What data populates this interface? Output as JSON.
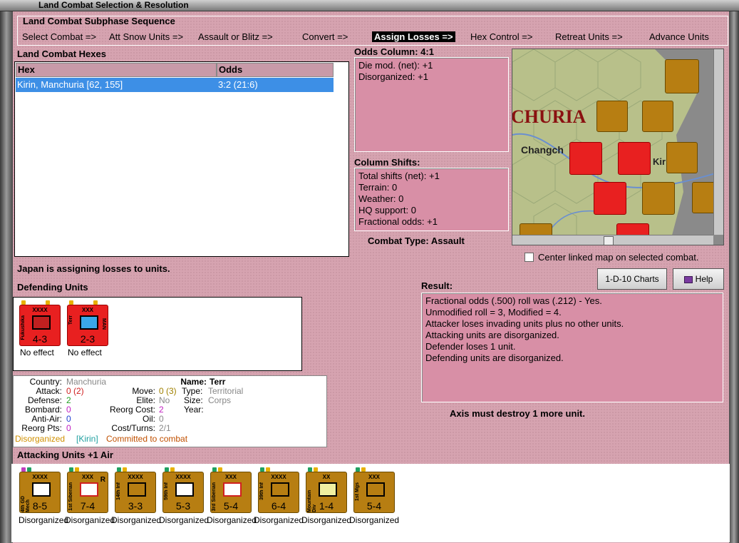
{
  "window": {
    "title": "Land Combat Selection & Resolution"
  },
  "sequence": {
    "title": "Land Combat Subphase Sequence",
    "steps": [
      "Select Combat =>",
      "Att Snow Units =>",
      "Assault or Blitz =>",
      "Convert =>",
      "Assign Losses =>",
      "Hex Control =>",
      "Retreat Units =>",
      "Advance Units"
    ],
    "active_index": 4
  },
  "hexes": {
    "title": "Land Combat Hexes",
    "headers": [
      "Hex",
      "Odds"
    ],
    "rows": [
      {
        "hex": "Kirin, Manchuria [62, 155]",
        "odds": "3:2 (21:6)"
      }
    ]
  },
  "odds": {
    "title": "Odds Column: 4:1",
    "lines": [
      "Die mod. (net): +1",
      "Disorganized: +1"
    ]
  },
  "shifts": {
    "title": "Column Shifts:",
    "lines": [
      "Total shifts (net): +1",
      "Terrain: 0",
      "Weather: 0",
      "HQ support: 0",
      "Fractional odds: +1"
    ]
  },
  "combat_type": "Combat Type:  Assault",
  "map": {
    "labels": [
      "CHURIA",
      "Changch",
      "Kir"
    ]
  },
  "center_link": "Center linked map on selected combat.",
  "buttons": {
    "charts": "1-D-10 Charts",
    "help": "Help"
  },
  "status": "Japan is assigning losses to units.",
  "result": {
    "title": "Result:",
    "lines": [
      "Fractional odds (.500) roll was (.212)  - Yes.",
      "Unmodified roll = 3, Modified = 4.",
      "Attacker loses invading units plus no other units.",
      "Attacking units are disorganized.",
      "Defender loses 1 unit.",
      "Defending units are disorganized."
    ]
  },
  "axis_msg": "Axis must destroy 1 more unit.",
  "defending": {
    "title": "Defending Units",
    "units": [
      {
        "name": "Fukushika",
        "size": "XXXX",
        "value": "4-3",
        "status": "No effect"
      },
      {
        "name": "Terr",
        "size": "XXX",
        "value": "2-3",
        "extra": "MAN",
        "status": "No effect"
      }
    ]
  },
  "info": {
    "country_l": "Country:",
    "country": "Manchuria",
    "attack_l": "Attack:",
    "attack": "0 (2)",
    "defense_l": "Defense:",
    "defense": "2",
    "bombard_l": "Bombard:",
    "bombard": "0",
    "antiair_l": "Anti-Air:",
    "antiair": "0",
    "reorgpts_l": "Reorg Pts:",
    "reorgpts": "0",
    "name_l": "Name:",
    "name": "Terr",
    "move_l": "Move:",
    "move": "0 (3)",
    "type_l": "Type:",
    "type": "Territorial",
    "elite_l": "Elite:",
    "elite": "No",
    "size_l": "Size:",
    "size": "Corps",
    "reorgcost_l": "Reorg Cost:",
    "reorgcost": "2",
    "year_l": "Year:",
    "oil_l": "Oil:",
    "oil": "0",
    "costturns_l": "Cost/Turns:",
    "costturns": "2/1",
    "status_disorg": "Disorganized",
    "status_hex": "[Kirin]",
    "status_committed": "Committed to combat"
  },
  "attacking": {
    "title": "Attacking Units +1 Air",
    "units": [
      {
        "name": "4th GD Mech",
        "size": "XXXX",
        "value": "8-5",
        "status": "Disorganized"
      },
      {
        "name": "1st Siberian",
        "size": "XXX",
        "value": "7-4",
        "status": "Disorganized",
        "mark": "R"
      },
      {
        "name": "14th Inf",
        "size": "XXXX",
        "value": "3-3",
        "status": "Disorganized"
      },
      {
        "name": "59th Inf",
        "size": "XXXX",
        "value": "5-3",
        "status": "Disorganized"
      },
      {
        "name": "3rd Siberian",
        "size": "XXX",
        "value": "5-4",
        "status": "Disorganized"
      },
      {
        "name": "39th Inf",
        "size": "XXXX",
        "value": "6-4",
        "status": "Disorganized"
      },
      {
        "name": "Mountain Div",
        "size": "XX",
        "value": "1-4",
        "status": "Disorganized"
      },
      {
        "name": "1st Mgs",
        "size": "XXX",
        "value": "5-4",
        "status": "Disorganized"
      }
    ]
  },
  "colors": {
    "bg": "#d6a3b0",
    "box": "#d88fa6",
    "sel": "#3d8fe6",
    "red_unit": "#e82020",
    "tan_unit": "#b77e12",
    "disorg": "#d09000",
    "committed": "#c05000"
  }
}
